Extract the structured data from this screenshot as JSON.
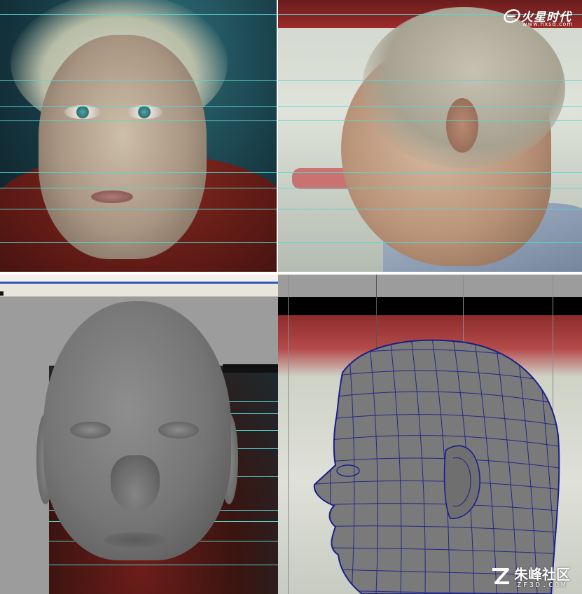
{
  "watermark_top": {
    "brand": "火星时代",
    "url": "www.hxsd.com"
  },
  "watermark_bottom": {
    "brand": "朱峰社区",
    "url": "ZF3D.COM"
  },
  "colors": {
    "guide_line": "#57d6d4",
    "viewport_bg": "#9c9c9c",
    "wireframe": "#1a1f8a",
    "model_gray": "#777777"
  },
  "icons": {
    "watermark_top_logo": "stylized-e-swoosh-logo",
    "watermark_bottom_logo": "z-arrow-logo"
  }
}
